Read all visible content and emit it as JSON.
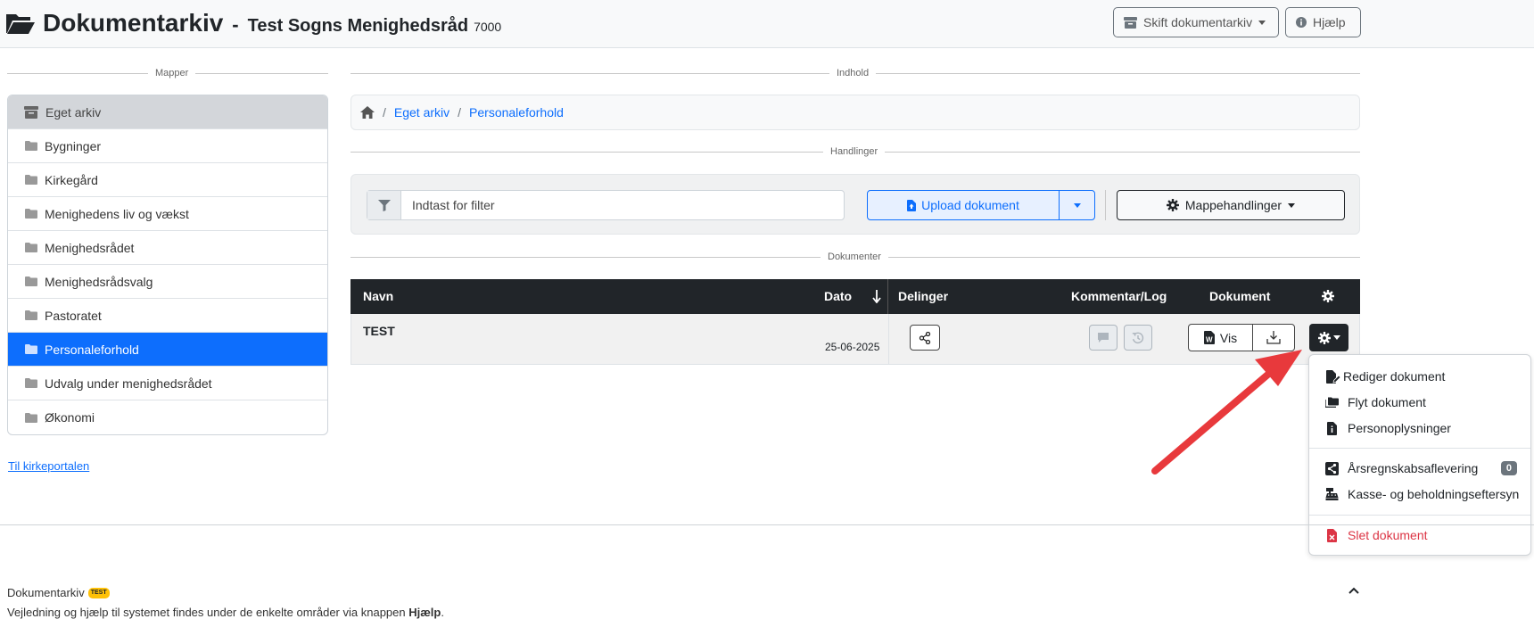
{
  "header": {
    "app_title": "Dokumentarkiv",
    "separator": "-",
    "org_name": "Test Sogns Menighedsråd",
    "org_number": "7000",
    "switch_archive_label": "Skift dokumentarkiv",
    "help_label": "Hjælp"
  },
  "sections": {
    "folders": "Mapper",
    "content": "Indhold",
    "actions": "Handlinger",
    "documents": "Dokumenter"
  },
  "sidebar": {
    "root_label": "Eget arkiv",
    "items": [
      {
        "label": "Bygninger",
        "active": false
      },
      {
        "label": "Kirkegård",
        "active": false
      },
      {
        "label": "Menighedens liv og vækst",
        "active": false
      },
      {
        "label": "Menighedsrådet",
        "active": false
      },
      {
        "label": "Menighedsrådsvalg",
        "active": false
      },
      {
        "label": "Pastoratet",
        "active": false
      },
      {
        "label": "Personaleforhold",
        "active": true
      },
      {
        "label": "Udvalg under menighedsrådet",
        "active": false
      },
      {
        "label": "Økonomi",
        "active": false
      }
    ],
    "portal_link": "Til kirkeportalen"
  },
  "breadcrumb": {
    "sep": "/",
    "items": [
      "Eget arkiv",
      "Personaleforhold"
    ]
  },
  "actions": {
    "filter_placeholder": "Indtast for filter",
    "upload_label": "Upload dokument",
    "folder_actions_label": "Mappehandlinger"
  },
  "table": {
    "headers": {
      "name": "Navn",
      "date": "Dato",
      "shares": "Delinger",
      "comment_log": "Kommentar/Log",
      "document": "Dokument"
    },
    "rows": [
      {
        "name": "TEST",
        "date": "25-06-2025",
        "view_label": "Vis"
      }
    ]
  },
  "menu": {
    "items": [
      {
        "label": "Rediger dokument",
        "icon": "file-edit-icon"
      },
      {
        "label": "Flyt dokument",
        "icon": "folders-icon"
      },
      {
        "label": "Personoplysninger",
        "icon": "file-info-icon"
      },
      {
        "label": "Årsregnskabsaflevering",
        "icon": "share-icon",
        "badge": "0"
      },
      {
        "label": "Kasse- og beholdningseftersyn",
        "icon": "cash-register-icon"
      },
      {
        "label": "Slet dokument",
        "icon": "file-delete-icon"
      }
    ]
  },
  "footer": {
    "title": "Dokumentarkiv",
    "badge": "TEST",
    "help_prefix": "Vejledning og hjælp til systemet findes under de enkelte områder via knappen",
    "help_bold": "Hjælp",
    "help_suffix": "."
  },
  "colors": {
    "primary": "#0d6efd",
    "dark": "#212529",
    "danger": "#dc3545",
    "warning": "#ffc107",
    "annotation_arrow": "#e8393c"
  }
}
